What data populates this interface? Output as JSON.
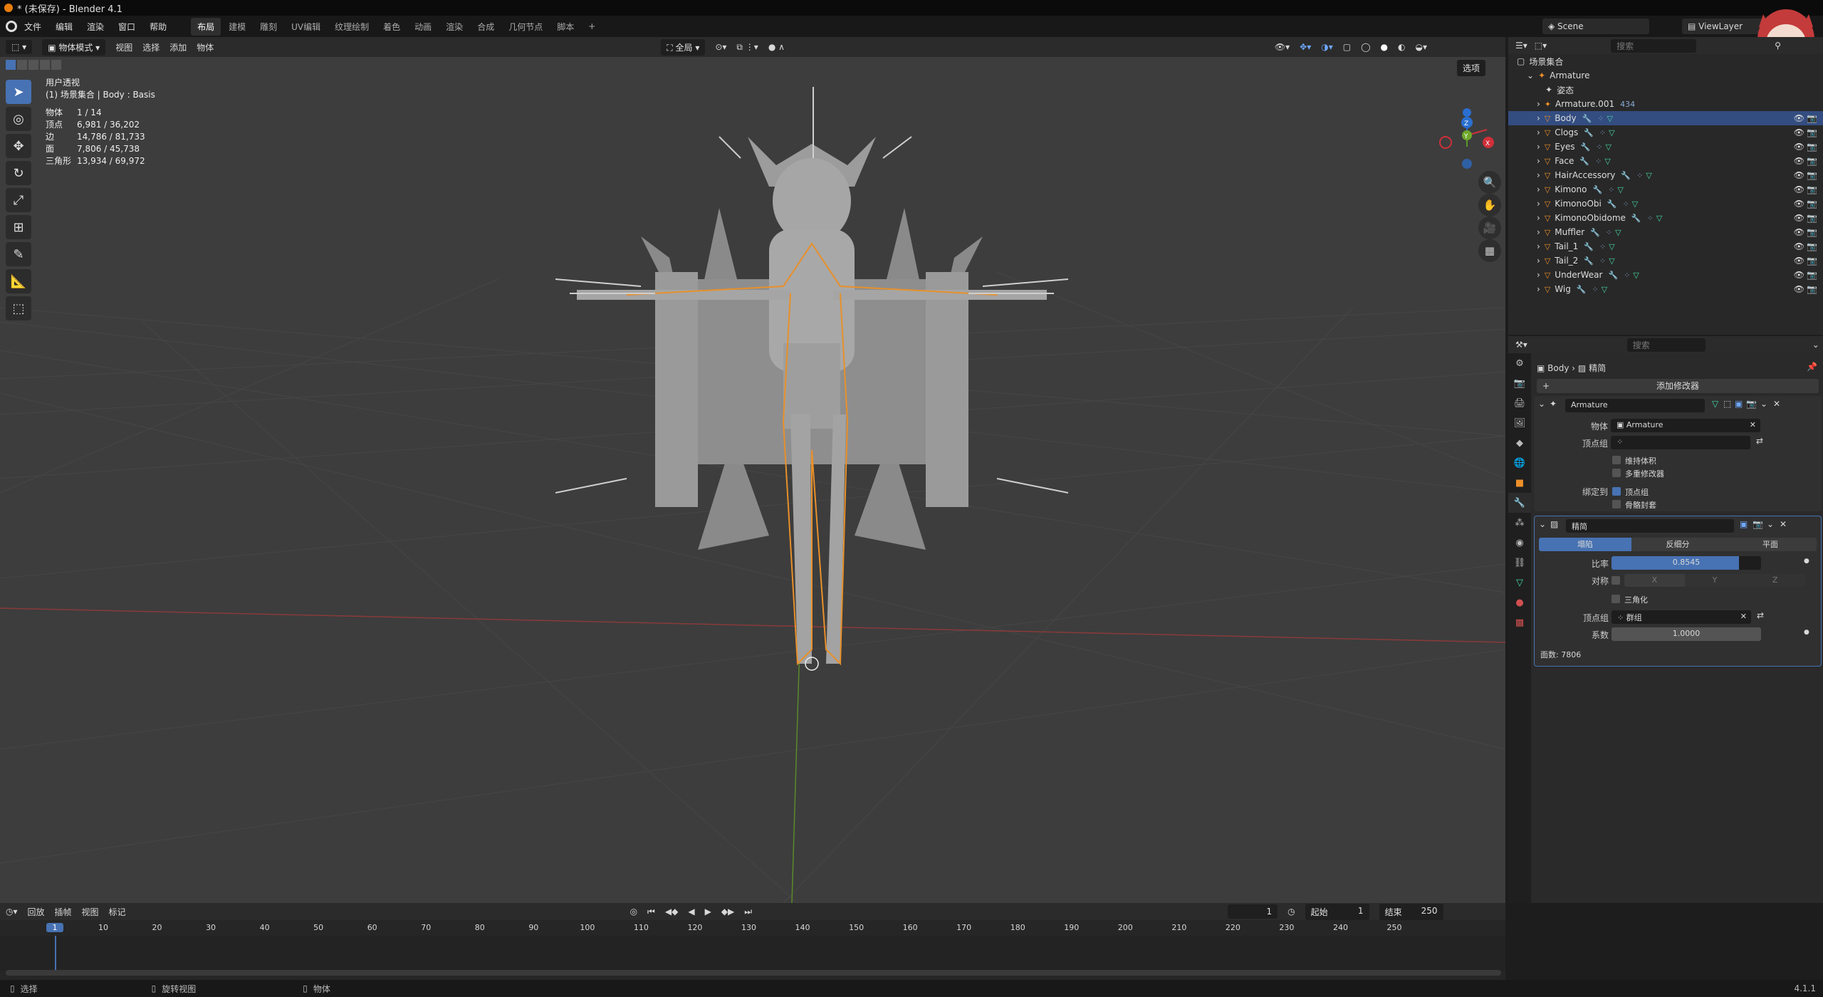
{
  "title": "* (未保存) - Blender 4.1",
  "menu": [
    "文件",
    "编辑",
    "渲染",
    "窗口",
    "帮助"
  ],
  "workspaces": [
    "布局",
    "建模",
    "雕刻",
    "UV编辑",
    "纹理绘制",
    "着色",
    "动画",
    "渲染",
    "合成",
    "几何节点",
    "脚本"
  ],
  "active_workspace": "布局",
  "scene_name": "Scene",
  "view_layer": "ViewLayer",
  "viewport": {
    "mode": "物体模式",
    "menus": [
      "视图",
      "选择",
      "添加",
      "物体"
    ],
    "orientation": "全局",
    "options_label": "选项",
    "view_name": "用户透视",
    "collection_line": "(1) 场景集合 | Body : Basis",
    "stats": [
      {
        "k": "物体",
        "v": "1 / 14"
      },
      {
        "k": "顶点",
        "v": "6,981 / 36,202"
      },
      {
        "k": "边",
        "v": "14,786 / 81,733"
      },
      {
        "k": "面",
        "v": "7,806 / 45,738"
      },
      {
        "k": "三角形",
        "v": "13,934 / 69,972"
      }
    ],
    "gizmo_axes": [
      "X",
      "Y",
      "Z"
    ]
  },
  "outliner": {
    "search_placeholder": "搜索",
    "root": "场景集合",
    "armature": "Armature",
    "pose": "姿态",
    "items": [
      "Armature.001",
      "Body",
      "Clogs",
      "Eyes",
      "Face",
      "HairAccessory",
      "Kimono",
      "KimonoObi",
      "KimonoObidome",
      "Muffler",
      "Tail_1",
      "Tail_2",
      "UnderWear",
      "Wig"
    ],
    "selected": "Body",
    "armature_count": "434"
  },
  "properties": {
    "search_placeholder": "搜索",
    "breadcrumb_obj": "Body",
    "breadcrumb_mod": "精简",
    "add_modifier": "添加修改器",
    "armature_mod": {
      "name": "Armature",
      "object_label": "物体",
      "object_value": "Armature",
      "vgroup_label": "顶点组",
      "preserve_volume": "维持体积",
      "multi_modifier": "多重修改器",
      "bind_to": "绑定到",
      "vertex_groups": "顶点组",
      "bone_envelopes": "骨骼封套"
    },
    "decimate_mod": {
      "name": "精简",
      "tabs": [
        "塌陷",
        "反细分",
        "平面"
      ],
      "active_tab": "塌陷",
      "ratio_label": "比率",
      "ratio_value": "0.8545",
      "ratio": 0.8545,
      "symmetry_label": "对称",
      "sym_axes": [
        "X",
        "Y",
        "Z"
      ],
      "triangulate": "三角化",
      "vgroup_label": "顶点组",
      "vgroup_value": "群组",
      "factor_label": "系数",
      "factor_value": "1.0000",
      "face_count": "面数: 7806"
    }
  },
  "timeline": {
    "menus": [
      "回放",
      "插帧",
      "视图",
      "标记"
    ],
    "current_frame": "1",
    "start_label": "起始",
    "start": "1",
    "end_label": "结束",
    "end": "250",
    "ticks": [
      "1",
      "10",
      "20",
      "30",
      "40",
      "50",
      "60",
      "70",
      "80",
      "90",
      "100",
      "110",
      "120",
      "130",
      "140",
      "150",
      "160",
      "170",
      "180",
      "190",
      "200",
      "210",
      "220",
      "230",
      "240",
      "250"
    ]
  },
  "status": {
    "select": "选择",
    "rotate": "旋转视图",
    "object": "物体",
    "version": "4.1.1"
  }
}
